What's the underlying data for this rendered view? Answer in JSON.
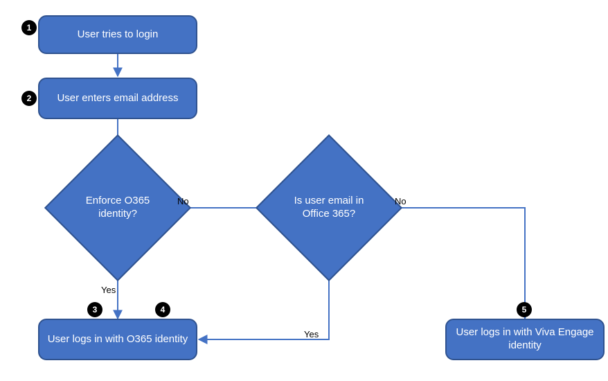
{
  "nodes": {
    "step1": {
      "label": "User tries to login"
    },
    "step2": {
      "label": "User enters email address"
    },
    "decision1": {
      "label": "Enforce O365 identity?"
    },
    "decision2": {
      "label": "Is user email in Office 365?"
    },
    "step3": {
      "label": "User logs in with O365 identity"
    },
    "step5": {
      "label": "User logs in with Viva Engage identity"
    }
  },
  "badges": {
    "b1": "1",
    "b2": "2",
    "b3": "3",
    "b4": "4",
    "b5": "5"
  },
  "edges": {
    "d1_yes": "Yes",
    "d1_no": "No",
    "d2_yes": "Yes",
    "d2_no": "No"
  },
  "colors": {
    "nodeFill": "#4472C4",
    "nodeBorder": "#2F528F",
    "arrow": "#4472C4",
    "badge": "#000000"
  }
}
